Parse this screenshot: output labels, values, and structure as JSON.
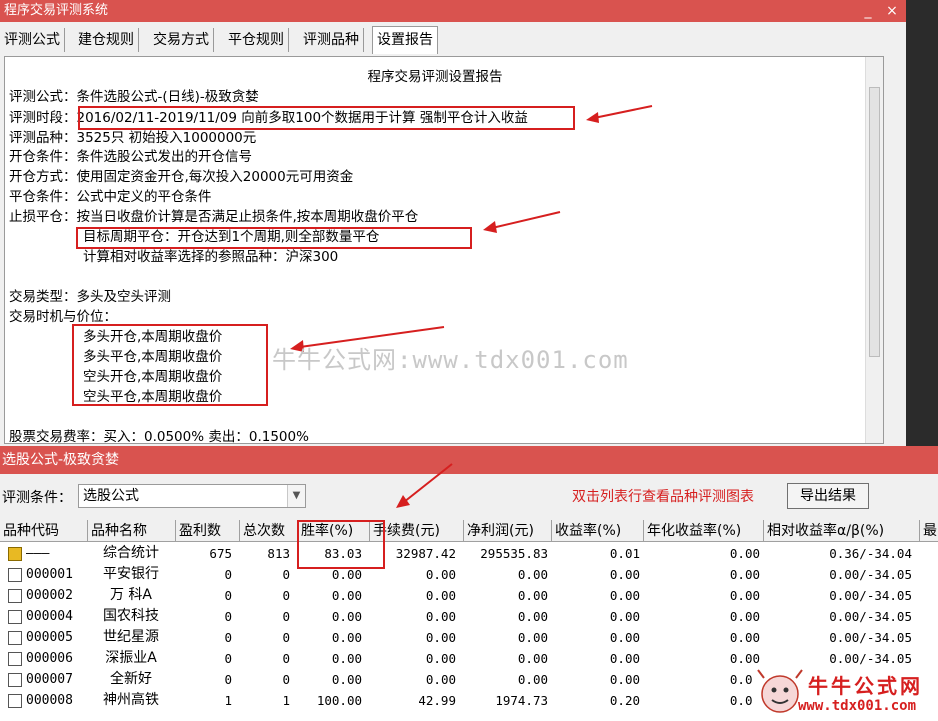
{
  "window": {
    "title": "程序交易评测系统",
    "minimize": "_",
    "close": "×"
  },
  "tabs": [
    "评测公式",
    "建仓规则",
    "交易方式",
    "平仓规则",
    "评测品种",
    "设置报告"
  ],
  "report": {
    "heading": "程序交易评测设置报告",
    "lines": [
      "评测公式：条件选股公式-(日线)-极致贪婪",
      "评测时段：2016/02/11-2019/11/09 向前多取100个数据用于计算 强制平仓计入收益",
      "评测品种：3525只 初始投入1000000元",
      "开仓条件：条件选股公式发出的开仓信号",
      "开仓方式：使用固定资金开仓,每次投入20000元可用资金",
      "平仓条件：公式中定义的平仓条件",
      "止损平仓：按当日收盘价计算是否满足止损条件,按本周期收盘价平仓",
      "目标周期平仓：开仓达到1个周期,则全部数量平仓",
      "计算相对收益率选择的参照品种：沪深300",
      "交易类型：多头及空头评测",
      "交易时机与价位：",
      "多头开仓,本周期收盘价",
      "多头平仓,本周期收盘价",
      "空头开仓,本周期收盘价",
      "空头平仓,本周期收盘价",
      "股票交易费率：买入：0.0500% 卖出：0.1500%"
    ]
  },
  "watermark": "牛牛公式网:www.tdx001.com",
  "panel": {
    "title": "选股公式-极致贪婪",
    "condition_label": "评测条件：",
    "condition_value": "选股公式",
    "hint": "双击列表行查看品种评测图表",
    "export_label": "导出结果"
  },
  "table": {
    "headers": [
      "品种代码",
      "品种名称",
      "盈利数",
      "总次数",
      "胜率(%)",
      "手续费(元)",
      "净利润(元)",
      "收益率(%)",
      "年化收益率(%)",
      "相对收益率α/β(%)",
      "最"
    ],
    "rows": [
      {
        "code": "———",
        "name": "综合统计",
        "win": "675",
        "total": "813",
        "rate": "83.03",
        "fee": "32987.42",
        "profit": "295535.83",
        "ret": "0.01",
        "annual": "0.00",
        "rel": "0.36/-34.04",
        "summary": true
      },
      {
        "code": "000001",
        "name": "平安银行",
        "win": "0",
        "total": "0",
        "rate": "0.00",
        "fee": "0.00",
        "profit": "0.00",
        "ret": "0.00",
        "annual": "0.00",
        "rel": "0.00/-34.05"
      },
      {
        "code": "000002",
        "name": "万 科A",
        "win": "0",
        "total": "0",
        "rate": "0.00",
        "fee": "0.00",
        "profit": "0.00",
        "ret": "0.00",
        "annual": "0.00",
        "rel": "0.00/-34.05"
      },
      {
        "code": "000004",
        "name": "国农科技",
        "win": "0",
        "total": "0",
        "rate": "0.00",
        "fee": "0.00",
        "profit": "0.00",
        "ret": "0.00",
        "annual": "0.00",
        "rel": "0.00/-34.05"
      },
      {
        "code": "000005",
        "name": "世纪星源",
        "win": "0",
        "total": "0",
        "rate": "0.00",
        "fee": "0.00",
        "profit": "0.00",
        "ret": "0.00",
        "annual": "0.00",
        "rel": "0.00/-34.05"
      },
      {
        "code": "000006",
        "name": "深振业A",
        "win": "0",
        "total": "0",
        "rate": "0.00",
        "fee": "0.00",
        "profit": "0.00",
        "ret": "0.00",
        "annual": "0.00",
        "rel": "0.00/-34.05"
      },
      {
        "code": "000007",
        "name": "全新好",
        "win": "0",
        "total": "0",
        "rate": "0.00",
        "fee": "0.00",
        "profit": "0.00",
        "ret": "0.00",
        "annual": "0.00",
        "rel": "0.00/-34.05"
      },
      {
        "code": "000008",
        "name": "神州高铁",
        "win": "1",
        "total": "1",
        "rate": "100.00",
        "fee": "42.99",
        "profit": "1974.73",
        "ret": "0.20",
        "annual": "0.00",
        "rel": "0.00/-34.05"
      }
    ]
  },
  "logo": {
    "name": "牛牛公式网",
    "url": "www.tdx001.com"
  },
  "colors": {
    "titlebar": "#d9534f",
    "highlight": "#d61f1f",
    "watermark": "#c8c8c8"
  }
}
